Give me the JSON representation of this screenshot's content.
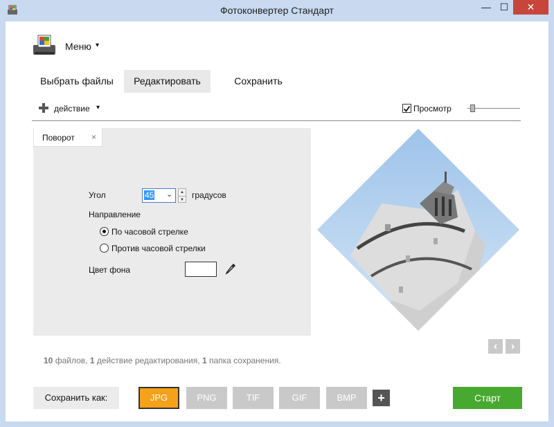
{
  "window": {
    "title": "Фотоконвертер Стандарт",
    "icons": {
      "app": "printer-photo-icon",
      "minimize": "minimize-icon",
      "maximize": "maximize-icon",
      "close": "close-icon"
    }
  },
  "menu": {
    "label": "Меню",
    "icon": "printer-photo-icon",
    "caret": "▾"
  },
  "tabs": [
    {
      "label": "Выбрать файлы",
      "active": false
    },
    {
      "label": "Редактировать",
      "active": true
    },
    {
      "label": "Сохранить",
      "active": false
    }
  ],
  "action_bar": {
    "label": "действие",
    "caret": "▾",
    "icon": "plus-icon"
  },
  "preview": {
    "label": "Просмотр",
    "checked": true,
    "zoom_level": 0.05
  },
  "rotate_panel": {
    "tab_label": "Поворот",
    "tab_close": "×",
    "angle_label": "Угол",
    "angle_value": "45",
    "angle_unit": "градусов",
    "direction_label": "Направление",
    "direction_options": [
      {
        "label": "По часовой стрелке",
        "selected": true
      },
      {
        "label": "Против часовой стрелки",
        "selected": false
      }
    ],
    "bg_color_label": "Цвет фона",
    "bg_color": "#ffffff"
  },
  "nav": {
    "prev": "‹",
    "next": "›"
  },
  "status": {
    "files_count": "10",
    "files_text": "файлов,",
    "actions_count": "1",
    "actions_text": "действие редактирования,",
    "folders_count": "1",
    "folders_text": "папка сохранения."
  },
  "save": {
    "label": "Сохранить как:",
    "formats": [
      "JPG",
      "PNG",
      "TIF",
      "GIF",
      "BMP"
    ],
    "selected_format": "JPG",
    "add": "+"
  },
  "start_button": "Старт",
  "colors": {
    "accent_orange": "#f5a11a",
    "start_green": "#47a92f",
    "close_red": "#c7453b",
    "window_frame": "#c8d9f0"
  }
}
